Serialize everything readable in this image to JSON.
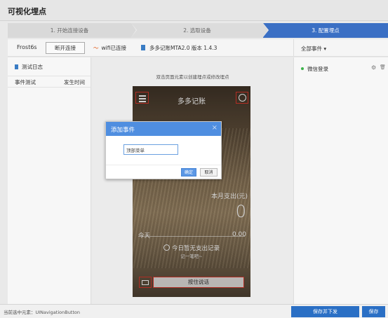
{
  "app": {
    "title": "可视化埋点"
  },
  "steps": [
    {
      "label": "1. 开始连接设备"
    },
    {
      "label": "2. 选取设备"
    },
    {
      "label": "3. 配置埋点"
    }
  ],
  "device": {
    "name": "Frost6s",
    "disconnect_label": "断开连接",
    "wifi_label": "wifi已连接",
    "app_version": "多多记账MTA2.0 版本 1.4.3"
  },
  "right_header": {
    "filter_label": "全部事件"
  },
  "left_panel": {
    "log_label": "测试日志",
    "col_event": "事件测试",
    "col_time": "发生时间"
  },
  "center": {
    "hint": "双击页面元素以创建埋点或修改埋点"
  },
  "phone": {
    "title": "多多记账",
    "month_label": "本月支出(元)",
    "month_value": "0",
    "today_label": "今天",
    "today_value": "0.00",
    "no_record": "今日暂无支出记录",
    "note": "记一笔吧~",
    "hold_button": "按住说话"
  },
  "modal": {
    "title": "添加事件",
    "close": "×",
    "input_value": "顶部菜单",
    "ok_label": "确定",
    "cancel_label": "取消"
  },
  "events": [
    {
      "name": "微信登录",
      "status_color": "#3bb34a"
    }
  ],
  "footer": {
    "status": "当前选中元素：UINavigationButton",
    "save_send_label": "保存并下发",
    "save_label": "保存"
  },
  "colors": {
    "accent": "#3a6fc4",
    "button_primary": "#2a6fc5",
    "highlight": "#d9382c"
  }
}
